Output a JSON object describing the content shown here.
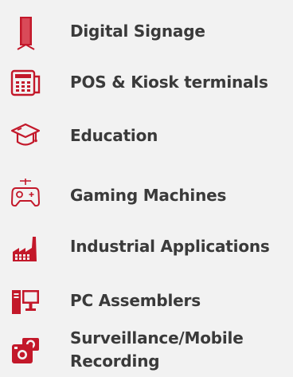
{
  "items": [
    {
      "label": "Digital Signage",
      "icon": "digital-signage-icon"
    },
    {
      "label": "POS & Kiosk terminals",
      "icon": "pos-terminal-icon"
    },
    {
      "label": "Education",
      "icon": "graduation-cap-icon"
    },
    {
      "label": "Gaming Machines",
      "icon": "gamepad-icon"
    },
    {
      "label": "Industrial Applications",
      "icon": "factory-icon"
    },
    {
      "label": "PC Assemblers",
      "icon": "desktop-pc-icon"
    },
    {
      "label": "Surveillance/Mobile Recording",
      "icon": "camera-icon"
    }
  ],
  "colors": {
    "accent": "#c3182a",
    "text": "#3a3a3a",
    "background": "#f2f2f2"
  }
}
